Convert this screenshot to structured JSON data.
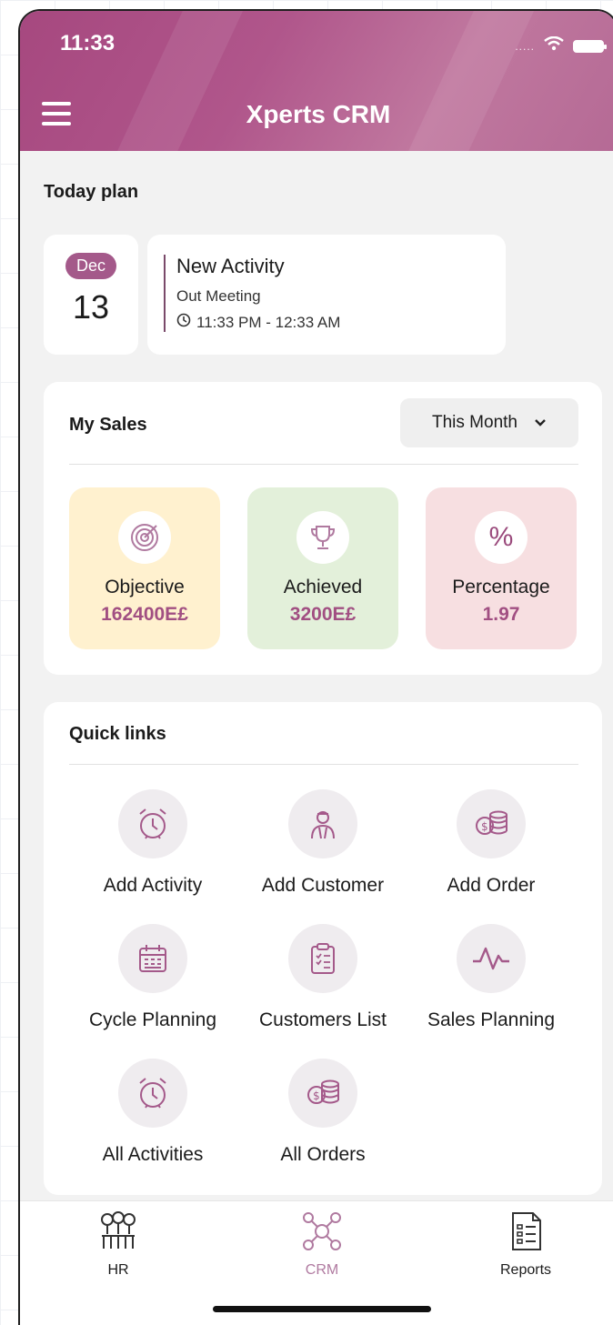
{
  "status_bar": {
    "time": "11:33",
    "signal": "....."
  },
  "header": {
    "title": "Xperts CRM"
  },
  "today_plan": {
    "title": "Today plan",
    "date": {
      "month": "Dec",
      "day": "13"
    },
    "activity": {
      "title": "New Activity",
      "type": "Out Meeting",
      "time": "11:33 PM - 12:33 AM"
    }
  },
  "my_sales": {
    "title": "My Sales",
    "period": "This Month",
    "stats": [
      {
        "label": "Objective",
        "value": "162400E£",
        "bg": "#fff1cf"
      },
      {
        "label": "Achieved",
        "value": "3200E£",
        "bg": "#e3f0da"
      },
      {
        "label": "Percentage",
        "value": "1.97",
        "bg": "#f7dfe1"
      }
    ]
  },
  "quick_links": {
    "title": "Quick links",
    "items": [
      {
        "label": "Add Activity",
        "icon": "alarm-clock-icon"
      },
      {
        "label": "Add Customer",
        "icon": "person-icon"
      },
      {
        "label": "Add Order",
        "icon": "coins-icon"
      },
      {
        "label": "Cycle Planning",
        "icon": "calendar-icon"
      },
      {
        "label": "Customers List",
        "icon": "clipboard-list-icon"
      },
      {
        "label": "Sales Planning",
        "icon": "pulse-icon"
      },
      {
        "label": "All Activities",
        "icon": "alarm-clock-icon"
      },
      {
        "label": "All Orders",
        "icon": "coins-icon"
      }
    ]
  },
  "tabbar": {
    "tabs": [
      {
        "label": "HR",
        "active": false
      },
      {
        "label": "CRM",
        "active": true
      },
      {
        "label": "Reports",
        "active": false
      }
    ]
  },
  "colors": {
    "accent": "#a4598a",
    "value_text": "#a14f82",
    "active_tab": "#b07aa0"
  }
}
